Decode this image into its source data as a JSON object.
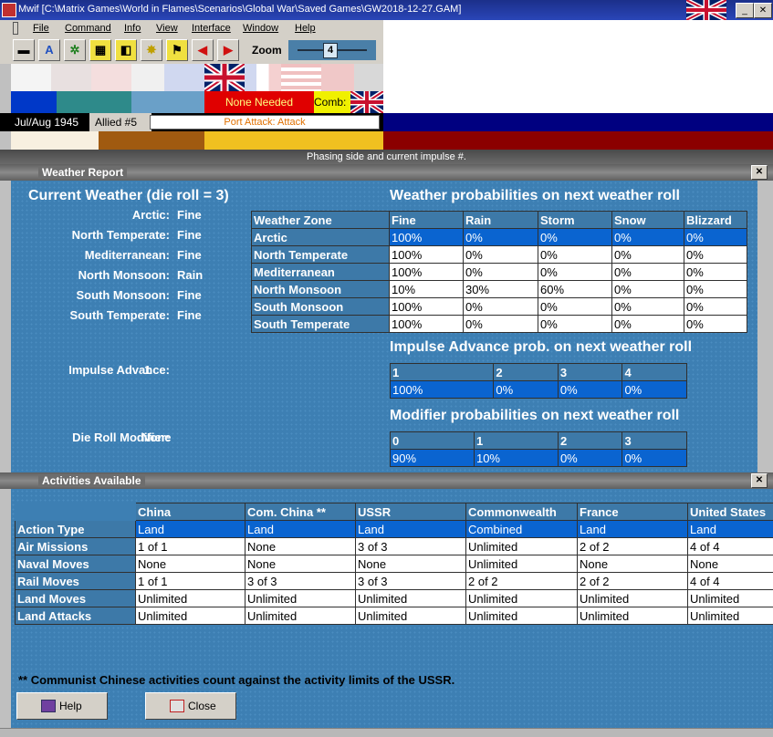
{
  "window": {
    "title": "Mwif [C:\\Matrix Games\\World in Flames\\Scenarios\\Global War\\Saved Games\\GW2018-12-27.GAM]"
  },
  "menu": [
    "File",
    "Command",
    "Info",
    "View",
    "Interface",
    "Window",
    "Help"
  ],
  "toolbar": {
    "zoom_label": "Zoom",
    "zoom_value": "4"
  },
  "status": {
    "none_needed": "None Needed",
    "comb": "Comb:",
    "date": "Jul/Aug 1945",
    "impulse": "Allied #5",
    "port_attack": "Port Attack: Attack",
    "hint": "Phasing side and current impulse #."
  },
  "weather": {
    "panel_title": "Weather Report",
    "current_title": "Current Weather (die roll = 3)",
    "zones": [
      {
        "label": "Arctic:",
        "value": "Fine"
      },
      {
        "label": "North Temperate:",
        "value": "Fine"
      },
      {
        "label": "Mediterranean:",
        "value": "Fine"
      },
      {
        "label": "North Monsoon:",
        "value": "Rain"
      },
      {
        "label": "South Monsoon:",
        "value": "Fine"
      },
      {
        "label": "South Temperate:",
        "value": "Fine"
      }
    ],
    "impulse_label": "Impulse Advance:",
    "impulse_value": "1",
    "modifier_label": "Die Roll Modifier:",
    "modifier_value": "None",
    "prob_title": "Weather probabilities on next weather roll",
    "prob_headers": [
      "Weather Zone",
      "Fine",
      "Rain",
      "Storm",
      "Snow",
      "Blizzard"
    ],
    "prob_rows": [
      [
        "Arctic",
        "100%",
        "0%",
        "0%",
        "0%",
        "0%"
      ],
      [
        "North Temperate",
        "100%",
        "0%",
        "0%",
        "0%",
        "0%"
      ],
      [
        "Mediterranean",
        "100%",
        "0%",
        "0%",
        "0%",
        "0%"
      ],
      [
        "North Monsoon",
        "10%",
        "30%",
        "60%",
        "0%",
        "0%"
      ],
      [
        "South Monsoon",
        "100%",
        "0%",
        "0%",
        "0%",
        "0%"
      ],
      [
        "South Temperate",
        "100%",
        "0%",
        "0%",
        "0%",
        "0%"
      ]
    ],
    "impulse_title": "Impulse Advance prob. on next weather roll",
    "impulse_headers": [
      "1",
      "2",
      "3",
      "4"
    ],
    "impulse_row": [
      "100%",
      "0%",
      "0%",
      "0%"
    ],
    "modifier_title": "Modifier probabilities on next weather roll",
    "modifier_headers": [
      "0",
      "1",
      "2",
      "3"
    ],
    "modifier_row": [
      "90%",
      "10%",
      "0%",
      "0%"
    ]
  },
  "activities": {
    "panel_title": "Activities Available",
    "headers": [
      "",
      "China",
      "Com. China **",
      "USSR",
      "Commonwealth",
      "France",
      "United States"
    ],
    "rows": [
      [
        "Action Type",
        "Land",
        "Land",
        "Land",
        "Combined",
        "Land",
        "Land"
      ],
      [
        "Air Missions",
        "1 of 1",
        "None",
        "3 of 3",
        "Unlimited",
        "2 of 2",
        "4 of 4"
      ],
      [
        "Naval Moves",
        "None",
        "None",
        "None",
        "Unlimited",
        "None",
        "None"
      ],
      [
        "Rail Moves",
        "1 of 1",
        "3 of 3",
        "3 of 3",
        "2 of 2",
        "2 of 2",
        "4 of 4"
      ],
      [
        "Land Moves",
        "Unlimited",
        "Unlimited",
        "Unlimited",
        "Unlimited",
        "Unlimited",
        "Unlimited"
      ],
      [
        "Land Attacks",
        "Unlimited",
        "Unlimited",
        "Unlimited",
        "Unlimited",
        "Unlimited",
        "Unlimited"
      ]
    ],
    "footnote": "** Communist Chinese activities count against the activity limits of the USSR.",
    "help_label": "Help",
    "close_label": "Close"
  }
}
